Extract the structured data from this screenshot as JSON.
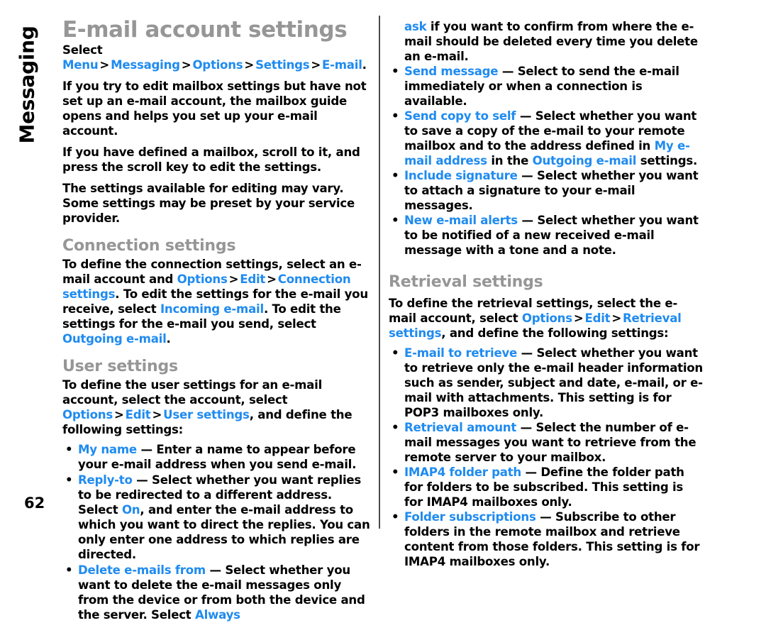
{
  "side_tab": {
    "label": "Messaging"
  },
  "page_number": "62",
  "document": {
    "title": "E-mail account settings"
  },
  "left_column": {
    "intro_select": {
      "lead": "Select",
      "path": [
        "Menu",
        "Messaging",
        "Options",
        "Settings",
        "E-mail"
      ],
      "separator": ">",
      "trailing": "."
    },
    "paragraphs": [
      "If you try to edit mailbox settings but have not set up an e-mail account, the mailbox guide opens and helps you set up your e-mail account.",
      "If you have defined a mailbox, scroll to it, and press the scroll key to edit the settings.",
      "The settings available for editing may vary. Some settings may be preset by your service provider."
    ],
    "connection_settings": {
      "heading": "Connection settings",
      "body_1": "To define the connection settings, select an e-mail account and ",
      "kw_options": "Options",
      "kw_edit": "Edit",
      "kw_connection_settings": "Connection settings",
      "body_2": ". To edit the settings for the e-mail you receive, select ",
      "kw_incoming": "Incoming e-mail",
      "body_3": ". To edit the settings for the e-mail you send, select ",
      "kw_outgoing": "Outgoing e-mail",
      "body_4": "."
    },
    "user_settings": {
      "heading": "User settings",
      "body_1": "To define the user settings for an e-mail account, select the account, select ",
      "kw_options": "Options",
      "kw_edit": "Edit",
      "kw_user_settings": "User settings",
      "body_2": ", and define the following settings:",
      "bullets": [
        {
          "term": "My name",
          "dash": "—",
          "text": "Enter a name to appear before your e-mail address when you send e-mail."
        },
        {
          "term": "Reply-to",
          "dash": "—",
          "text_1": "Select whether you want replies to be redirected to a different address. Select ",
          "kw_on": "On",
          "text_2": ", and enter the e-mail address to which you want to direct the replies. You can only enter one address to which replies are directed."
        },
        {
          "term": "Delete e-mails from",
          "dash": "—",
          "text_1": "Select whether you want to delete the e-mail messages only from the device or from both the device and the server. Select ",
          "kw_always": "Always"
        }
      ]
    }
  },
  "right_column": {
    "continuation": {
      "kw_ask": "ask",
      "text": " if you want to confirm from where the e-mail should be deleted every time you delete an e-mail."
    },
    "sending_bullets": [
      {
        "term": "Send message",
        "dash": "—",
        "text": "Select to send the e-mail immediately or when a connection is available."
      },
      {
        "term": "Send copy to self",
        "dash": "—",
        "text_1": "Select whether you want to save a copy of the e-mail to your remote mailbox and to the address defined in ",
        "kw_my_address": "My e-mail address",
        "text_2": " in the ",
        "kw_outgoing": "Outgoing e-mail",
        "text_3": " settings."
      },
      {
        "term": "Include signature",
        "dash": "—",
        "text": "Select whether you want to attach a signature to your e-mail messages."
      },
      {
        "term": "New e-mail alerts",
        "dash": "—",
        "text": "Select whether you want to be notified of a new received e-mail message with a tone and a note."
      }
    ],
    "retrieval_settings": {
      "heading": "Retrieval settings",
      "body_1": "To define the retrieval settings, select the e-mail account, select ",
      "kw_options": "Options",
      "kw_edit": "Edit",
      "kw_retrieval_settings": "Retrieval settings",
      "body_2": ", and define the following settings:",
      "bullets": [
        {
          "term": "E-mail to retrieve",
          "dash": "—",
          "text": "Select whether you want to retrieve only the e-mail header information such as sender, subject and date, e-mail, or e-mail with attachments. This setting is for POP3 mailboxes only."
        },
        {
          "term": "Retrieval amount",
          "dash": "—",
          "text": "Select the number of e-mail messages you want to retrieve from the remote server to your mailbox."
        },
        {
          "term": "IMAP4 folder path",
          "dash": "—",
          "text": "Define the folder path for folders to be subscribed. This setting is for IMAP4 mailboxes only."
        },
        {
          "term": "Folder subscriptions",
          "dash": "—",
          "text": "Subscribe to other folders in the remote mailbox and retrieve content from those folders. This setting is for IMAP4 mailboxes only."
        }
      ]
    }
  },
  "colors": {
    "keyword_blue": "#1f8bf0",
    "heading_gray": "#969696",
    "body_black": "#000000",
    "divider_gray": "#4b4b4b"
  },
  "glyphs": {
    "bullet": "•",
    "chevron": ">"
  }
}
